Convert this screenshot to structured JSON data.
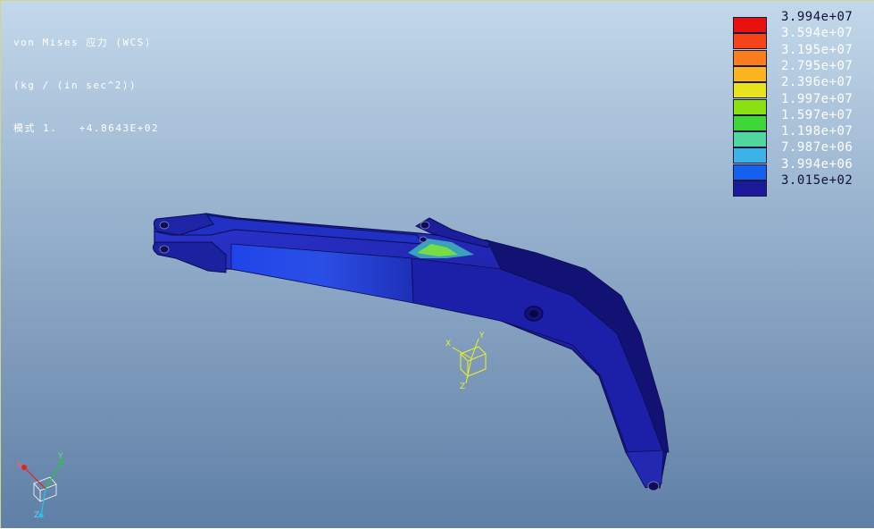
{
  "info": {
    "line1": "von Mises 应力 (WCS)",
    "line2": "(kg / (in sec^2))",
    "line3": "模式 1.   +4.8643E+02"
  },
  "legend": {
    "labels": [
      "3.994e+07",
      "3.594e+07",
      "3.195e+07",
      "2.795e+07",
      "2.396e+07",
      "1.997e+07",
      "1.597e+07",
      "1.198e+07",
      "7.987e+06",
      "3.994e+06",
      "3.015e+02"
    ],
    "colors": [
      "#e8110f",
      "#f5431a",
      "#fb7d20",
      "#fdb421",
      "#e8e41d",
      "#8be012",
      "#3fd63a",
      "#52d6a0",
      "#3bb3e6",
      "#1660ef",
      "#1a1a9a"
    ]
  },
  "triad_main": {
    "x": "X",
    "y": "Y",
    "z": "Z"
  },
  "triad_small": {
    "x": "X",
    "y": "Y",
    "z": "Z"
  }
}
